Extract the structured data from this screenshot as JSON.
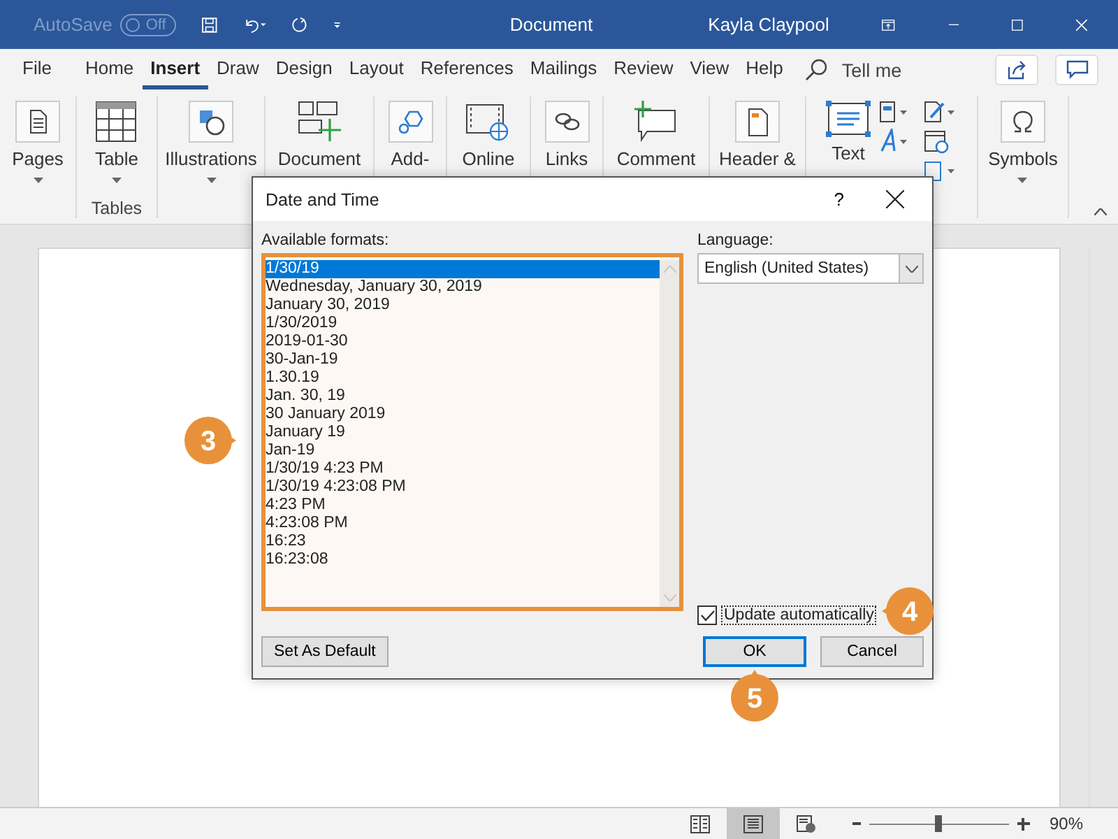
{
  "title_bar": {
    "autosave_label": "AutoSave",
    "autosave_toggle": {
      "text": "Off",
      "on": false
    },
    "title": "Document",
    "user": "Kayla Claypool"
  },
  "tabs": [
    {
      "label": "File",
      "selected": false
    },
    {
      "label": "Home",
      "selected": false
    },
    {
      "label": "Insert",
      "selected": true
    },
    {
      "label": "Draw",
      "selected": false
    },
    {
      "label": "Design",
      "selected": false
    },
    {
      "label": "Layout",
      "selected": false
    },
    {
      "label": "References",
      "selected": false
    },
    {
      "label": "Mailings",
      "selected": false
    },
    {
      "label": "Review",
      "selected": false
    },
    {
      "label": "View",
      "selected": false
    },
    {
      "label": "Help",
      "selected": false
    }
  ],
  "tell_me": "Tell me",
  "ribbon": [
    {
      "kind": "pages",
      "label": "Pages"
    },
    {
      "kind": "table",
      "label": "Table",
      "group": "Tables"
    },
    {
      "kind": "illustrations",
      "label": "Illustrations"
    },
    {
      "kind": "document",
      "label": "Document"
    },
    {
      "kind": "addins",
      "label": "Add-"
    },
    {
      "kind": "video",
      "label": "Online"
    },
    {
      "kind": "links",
      "label": "Links"
    },
    {
      "kind": "comment",
      "label": "Comment"
    },
    {
      "kind": "header",
      "label": "Header &"
    },
    {
      "kind": "text",
      "label": "Text"
    },
    {
      "kind": "symbols",
      "label": "Symbols"
    }
  ],
  "dialog": {
    "title": "Date and Time",
    "help": "?",
    "formats_label": "Available formats:",
    "formats": [
      {
        "text": "1/30/19",
        "selected": true
      },
      {
        "text": "Wednesday, January 30, 2019",
        "selected": false
      },
      {
        "text": "January 30, 2019",
        "selected": false
      },
      {
        "text": "1/30/2019",
        "selected": false
      },
      {
        "text": "2019-01-30",
        "selected": false
      },
      {
        "text": "30-Jan-19",
        "selected": false
      },
      {
        "text": "1.30.19",
        "selected": false
      },
      {
        "text": "Jan. 30, 19",
        "selected": false
      },
      {
        "text": "30 January 2019",
        "selected": false
      },
      {
        "text": "January 19",
        "selected": false
      },
      {
        "text": "Jan-19",
        "selected": false
      },
      {
        "text": "1/30/19 4:23 PM",
        "selected": false
      },
      {
        "text": "1/30/19 4:23:08 PM",
        "selected": false
      },
      {
        "text": "4:23 PM",
        "selected": false
      },
      {
        "text": "4:23:08 PM",
        "selected": false
      },
      {
        "text": "16:23",
        "selected": false
      },
      {
        "text": "16:23:08",
        "selected": false
      }
    ],
    "language_label": "Language:",
    "language": "English (United States)",
    "update_automatically": {
      "label": "Update automatically",
      "checked": true
    },
    "buttons": [
      {
        "label": "Set As Default",
        "default": false
      },
      {
        "label": "OK",
        "default": true
      },
      {
        "label": "Cancel",
        "default": false
      }
    ]
  },
  "callouts": [
    {
      "number": "3"
    },
    {
      "number": "4"
    },
    {
      "number": "5"
    }
  ],
  "status_bar": {
    "views": [
      {
        "kind": "read",
        "selected": false
      },
      {
        "kind": "print",
        "selected": true
      },
      {
        "kind": "web",
        "selected": false
      }
    ],
    "zoom": {
      "level": 0.5
    },
    "zoom_text": "90%"
  }
}
